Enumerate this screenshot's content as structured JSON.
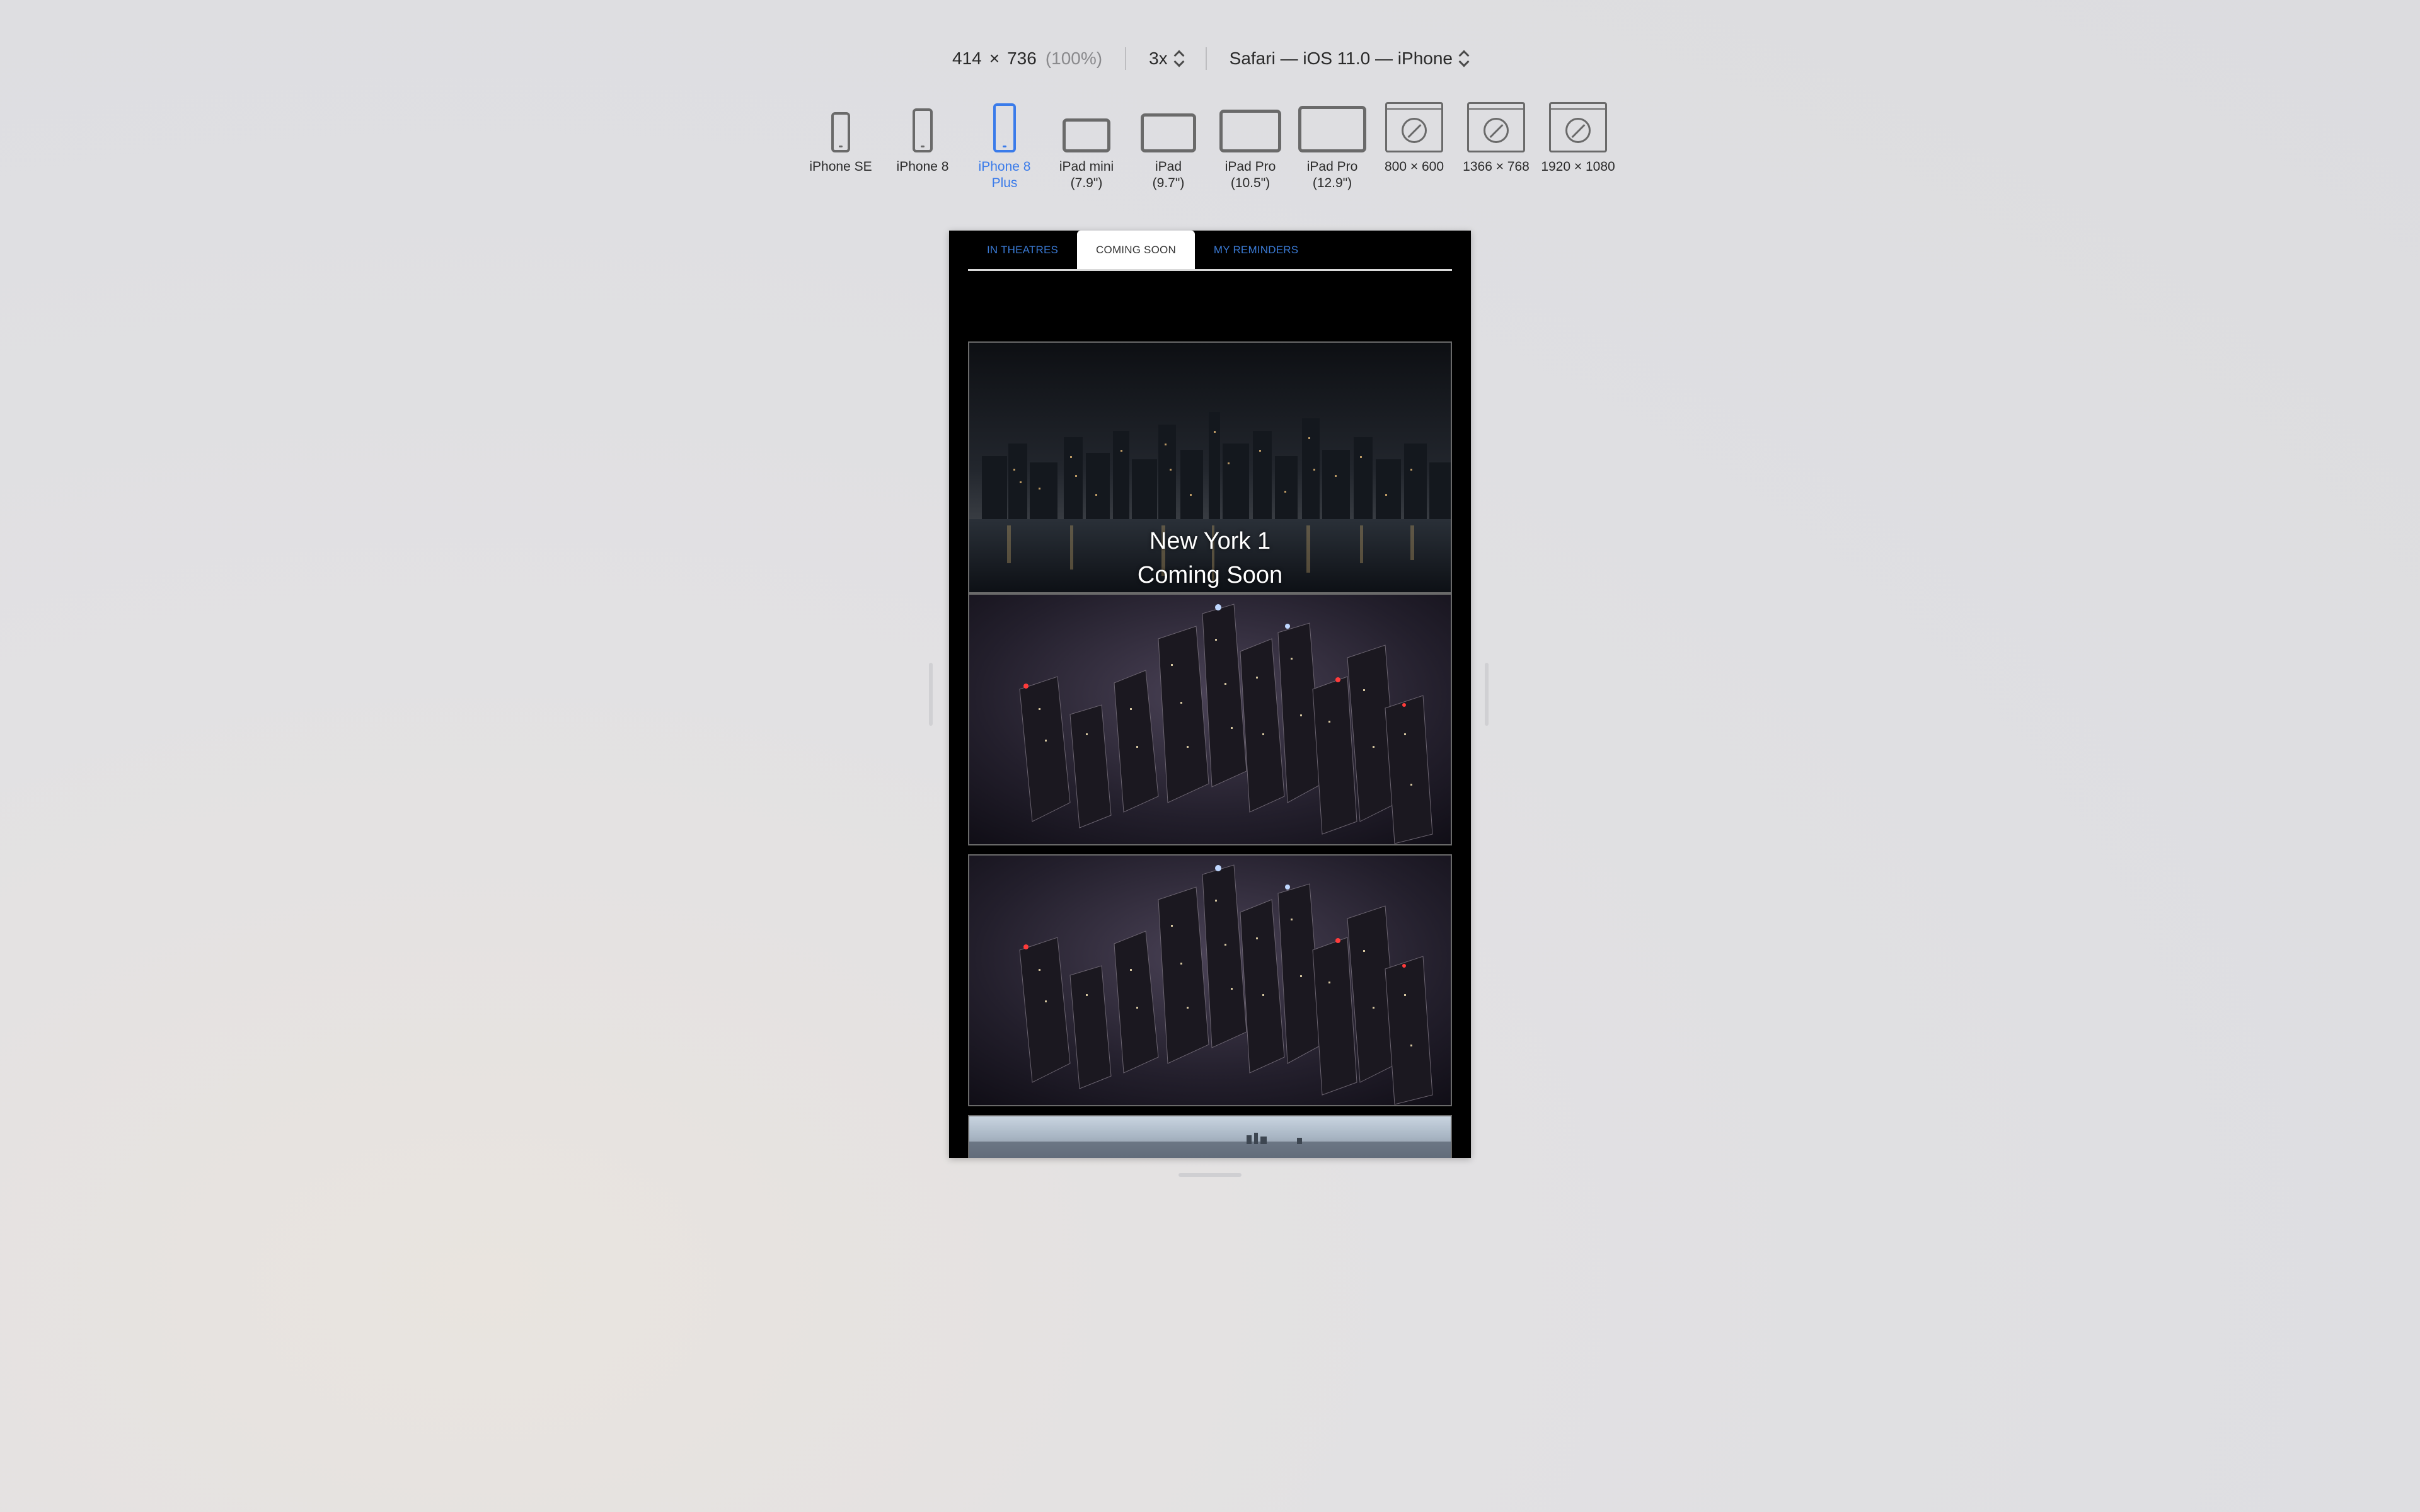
{
  "toolbar": {
    "width": "414",
    "times": "×",
    "height": "736",
    "zoom": "(100%)",
    "scale": "3x",
    "user_agent": "Safari — iOS 11.0 — iPhone"
  },
  "devices": [
    {
      "label_line1": "iPhone SE",
      "label_line2": "",
      "kind": "phone-icon",
      "selected": false
    },
    {
      "label_line1": "iPhone 8",
      "label_line2": "",
      "kind": "phone-icon",
      "selected": false
    },
    {
      "label_line1": "iPhone 8",
      "label_line2": "Plus",
      "kind": "phone-icon",
      "selected": true
    },
    {
      "label_line1": "iPad mini",
      "label_line2": "(7.9\")",
      "kind": "tablet-icon",
      "selected": false
    },
    {
      "label_line1": "iPad",
      "label_line2": "(9.7\")",
      "kind": "tablet-icon",
      "selected": false
    },
    {
      "label_line1": "iPad Pro",
      "label_line2": "(10.5\")",
      "kind": "tablet-icon",
      "selected": false
    },
    {
      "label_line1": "iPad Pro",
      "label_line2": "(12.9\")",
      "kind": "tablet-icon",
      "selected": false
    },
    {
      "label_line1": "800 × 600",
      "label_line2": "",
      "kind": "browser-icon",
      "selected": false
    },
    {
      "label_line1": "1366 × 768",
      "label_line2": "",
      "kind": "browser-icon",
      "selected": false
    },
    {
      "label_line1": "1920 × 1080",
      "label_line2": "",
      "kind": "browser-icon",
      "selected": false
    }
  ],
  "colors": {
    "accent": "#3a7bea",
    "tab_link": "#3b7bd6",
    "page_bg": "#000000"
  },
  "app": {
    "tabs": [
      {
        "label": "IN THEATRES",
        "active": false
      },
      {
        "label": "COMING SOON",
        "active": true
      },
      {
        "label": "MY REMINDERS",
        "active": false
      }
    ],
    "cards": [
      {
        "title": "New York 1",
        "subtitle": "Coming Soon",
        "image": "new-york-skyline-night-image"
      },
      {
        "title": "",
        "subtitle": "",
        "image": "city-aerial-night-image"
      },
      {
        "title": "",
        "subtitle": "",
        "image": "city-aerial-night-image"
      },
      {
        "title": "",
        "subtitle": "",
        "image": "city-aerial-day-image"
      }
    ]
  }
}
